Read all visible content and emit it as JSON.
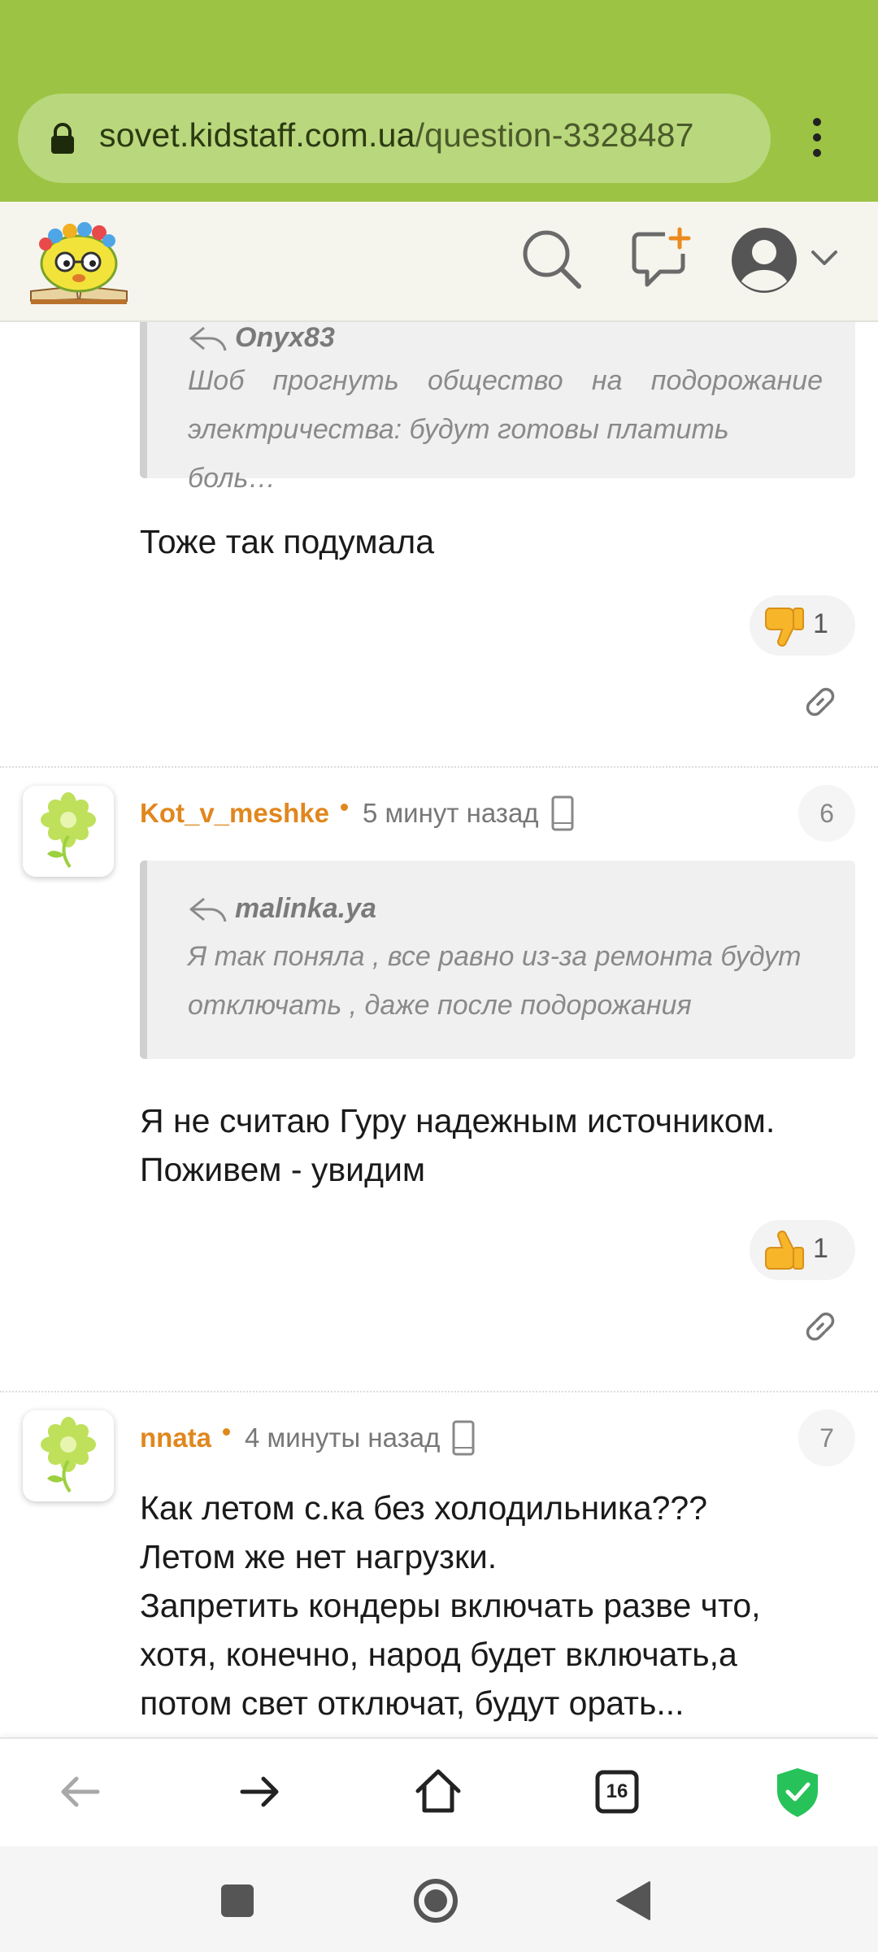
{
  "browser": {
    "url_domain": "sovet.kidstaff.com.ua",
    "url_path": "/question-3328487"
  },
  "icons": [
    "lock-icon",
    "kebab-menu-icon",
    "site-logo",
    "search-icon",
    "add-question-icon",
    "profile-icon",
    "chevron-down-icon",
    "reply-icon",
    "thumbs-down-icon",
    "thumbs-up-icon",
    "link-icon",
    "flower-avatar",
    "phone-icon",
    "back-arrow-icon",
    "forward-arrow-icon",
    "home-icon",
    "tabs-icon",
    "shield-check-icon",
    "square-icon",
    "circle-icon",
    "triangle-back-icon"
  ],
  "colors": {
    "browser_green": "#9cc343",
    "username_orange": "#e0871e",
    "shield_green": "#27c35a"
  },
  "comments": [
    {
      "quote_author": "Onyx83",
      "quote_line1": "Шоб прогнуть общество на подорожание",
      "quote_line2": "электричества: будут готовы платить боль…",
      "text": "Тоже так подумала",
      "reaction": "1"
    },
    {
      "username": "Kot_v_meshke",
      "time": "5 минут назад",
      "number": "6",
      "quote_author": "malinka.ya",
      "quote_line1": "Я так поняла , все равно из-за ремонта будут",
      "quote_line2": "отключать , даже после подорожания",
      "text_line1": "Я не считаю Гуру надежным источником.",
      "text_line2": "Поживем - увидим",
      "reaction": "1"
    },
    {
      "username": "nnata",
      "time": "4 минуты назад",
      "number": "7",
      "text_line1": "Как летом с.ка без холодильника???",
      "text_line2": "Летом же нет нагрузки.",
      "text_line3": "Запретить кондеры включать разве что,",
      "text_line4": "хотя, конечно, народ будет включать,а",
      "text_line5": "потом свет отключат, будут орать..."
    }
  ],
  "bottom_nav": {
    "tabs_count": "16"
  }
}
